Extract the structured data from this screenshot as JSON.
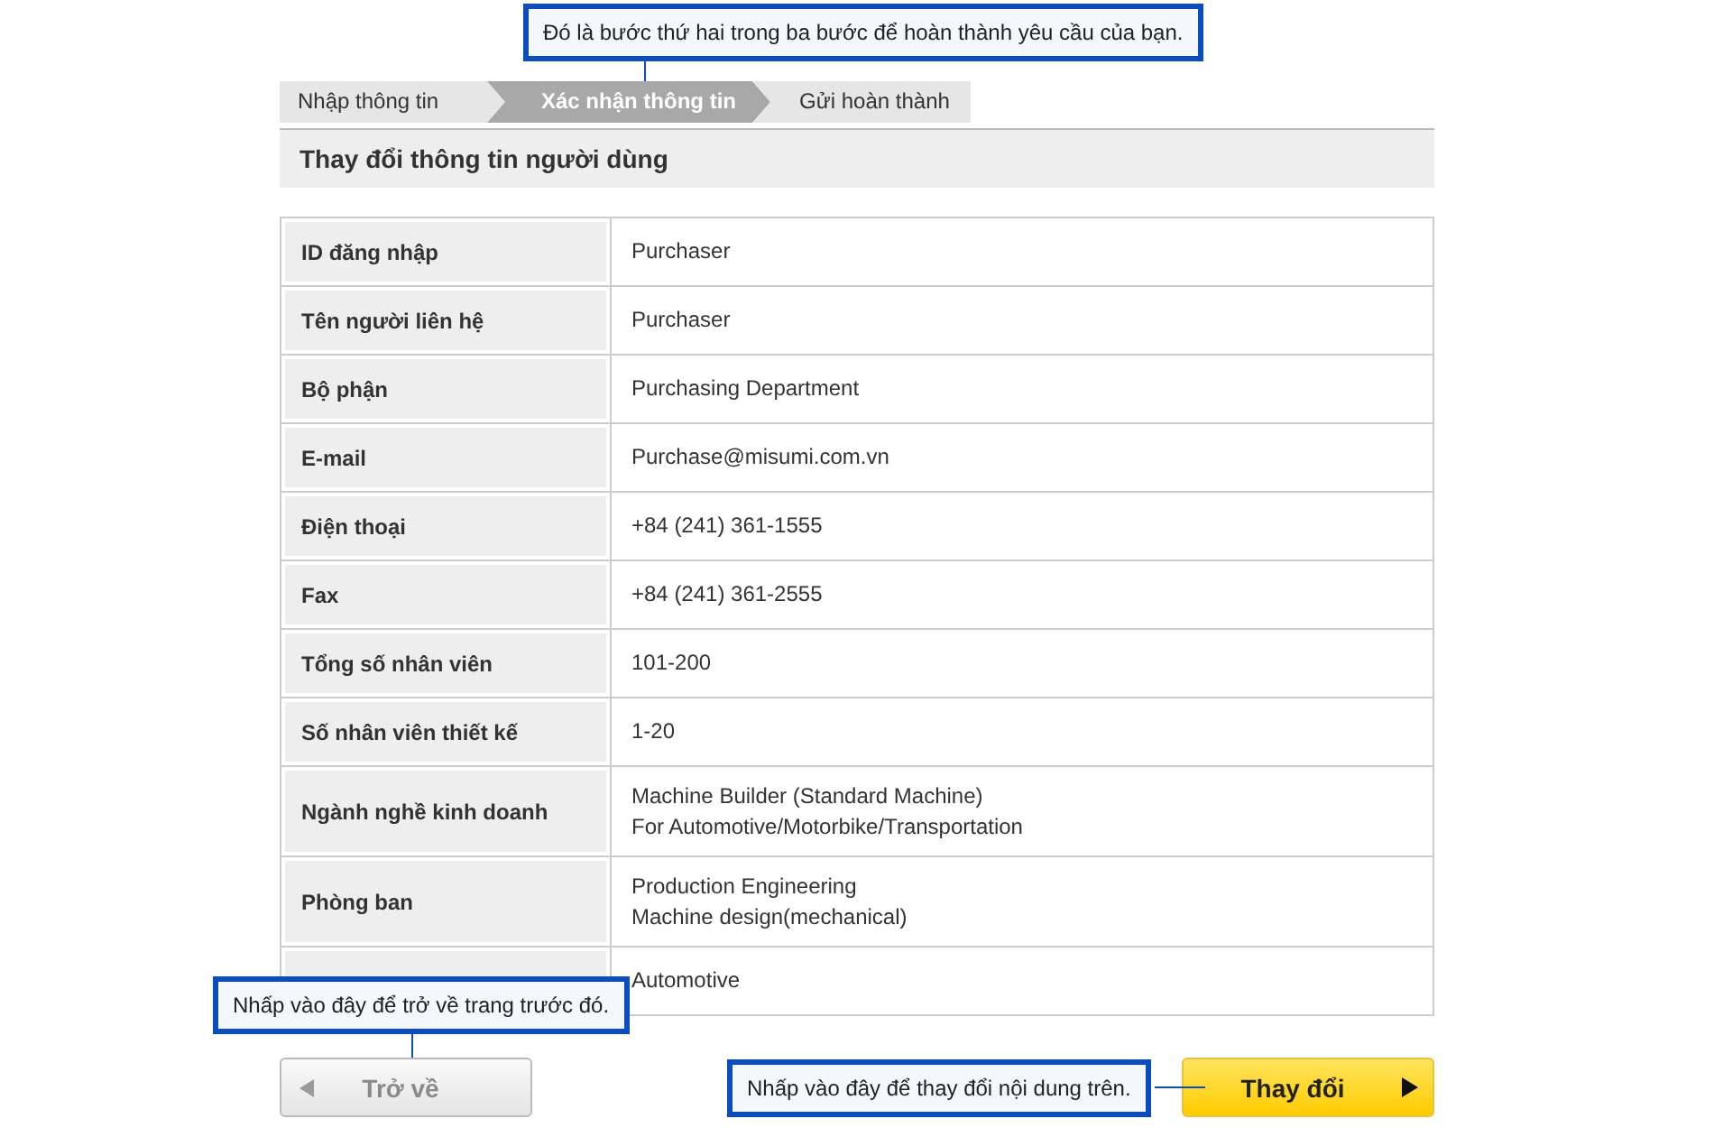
{
  "steps": [
    {
      "label": "Nhập thông tin",
      "selected": false
    },
    {
      "label": "Xác nhận thông tin",
      "selected": true
    },
    {
      "label": "Gửi hoàn thành",
      "selected": false
    }
  ],
  "steps_hint": "Đó là bước thứ hai trong ba bước để hoàn thành yêu cầu của bạn.",
  "section_title": "Thay đổi thông tin người dùng",
  "rows": [
    {
      "label": "ID đăng nhập",
      "value": [
        "Purchaser"
      ]
    },
    {
      "label": "Tên người liên hệ",
      "value": [
        "Purchaser"
      ]
    },
    {
      "label": "Bộ phận",
      "value": [
        "Purchasing Department"
      ]
    },
    {
      "label": "E-mail",
      "value": [
        "Purchase@misumi.com.vn"
      ]
    },
    {
      "label": "Điện thoại",
      "value": [
        "+84 (241) 361-1555"
      ]
    },
    {
      "label": "Fax",
      "value": [
        "+84 (241) 361-2555"
      ]
    },
    {
      "label": "Tổng số nhân viên",
      "value": [
        "101-200"
      ]
    },
    {
      "label": "Số nhân viên thiết kế",
      "value": [
        "1-20"
      ]
    },
    {
      "label": "Ngành nghề kinh doanh",
      "value": [
        "Machine Builder (Standard Machine)",
        "For Automotive/Motorbike/Transportation"
      ]
    },
    {
      "label": "Phòng ban",
      "value": [
        "Production Engineering",
        "Machine design(mechanical)"
      ]
    },
    {
      "value": [
        "Automotive"
      ]
    }
  ],
  "back_button": {
    "label": "Trở về",
    "hint": "Nhấp vào đây để trở về trang trước đó."
  },
  "change_button": {
    "label": "Thay đổi",
    "hint": "Nhấp vào đây để thay đổi nội dung  trên."
  }
}
